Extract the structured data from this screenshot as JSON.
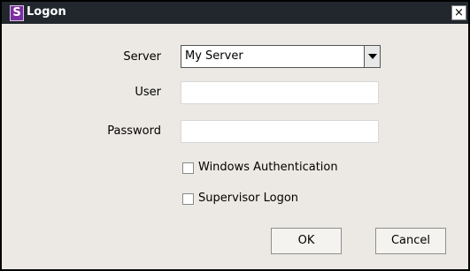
{
  "window": {
    "title": "Logon",
    "close_glyph": "×",
    "app_icon_letter": "S"
  },
  "form": {
    "server_label": "Server",
    "server_value": "My Server",
    "user_label": "User",
    "user_value": "",
    "password_label": "Password",
    "password_value": "",
    "windows_auth_label": "Windows Authentication",
    "windows_auth_checked": false,
    "supervisor_label": "Supervisor Logon",
    "supervisor_checked": false
  },
  "buttons": {
    "ok_label": "OK",
    "cancel_label": "Cancel"
  },
  "colors": {
    "titlebar": "#22262d",
    "dialog_bg": "#ece9e4",
    "app_icon": "#7b2f9e"
  },
  "icons": {
    "app": "app-logo-icon",
    "close": "close-icon",
    "dropdown": "chevron-down-icon"
  }
}
